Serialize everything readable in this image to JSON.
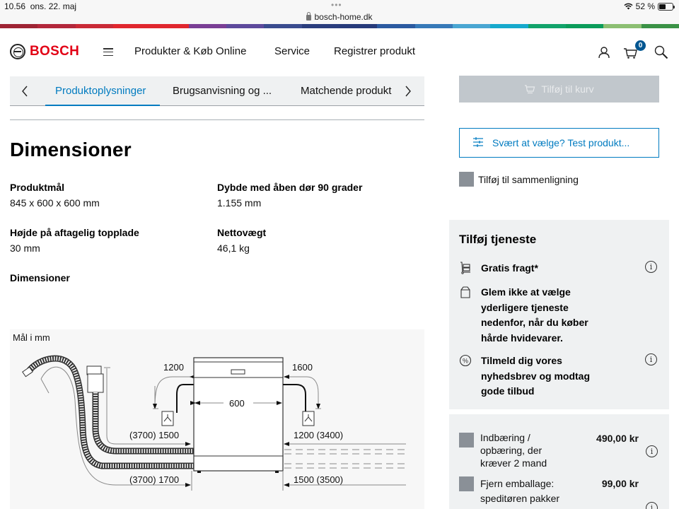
{
  "statusbar": {
    "time": "10.56",
    "date": "ons. 22. maj",
    "dots": "•••",
    "url": "bosch-home.dk",
    "battery": "52 %",
    "battery_level": 0.52
  },
  "supergraphic_colors": [
    "#9e2434",
    "#b3273b",
    "#c92a37",
    "#e0262e",
    "#e0262e",
    "#7a3e95",
    "#5d4a9c",
    "#3a4c8f",
    "#2a3d7d",
    "#263a7a",
    "#2b5aa0",
    "#3779b8",
    "#4aa6d2",
    "#16a9cc",
    "#11a36a",
    "#0b9c5a",
    "#8cbf72",
    "#3a9246"
  ],
  "header": {
    "brand": "BOSCH",
    "nav": [
      "Produkter & Køb Online",
      "Service",
      "Registrer produkt"
    ],
    "cart_count": "0",
    "brand_color": "#e20015"
  },
  "tabs": {
    "items": [
      {
        "label": "Produktoplysninger",
        "active": true
      },
      {
        "label": "Brugsanvisning og ..."
      },
      {
        "label": "Matchende produkt"
      }
    ],
    "accent_color": "#007bc0"
  },
  "main": {
    "title": "Dimensioner",
    "specs": [
      {
        "label": "Produktmål",
        "value": "845 x 600 x 600 mm"
      },
      {
        "label": "Dybde med åben dør 90 grader",
        "value": "1.155 mm"
      },
      {
        "label": "Højde på aftagelig topplade",
        "value": "30 mm"
      },
      {
        "label": "Nettovægt",
        "value": "46,1 kg"
      }
    ],
    "subheading": "Dimensioner",
    "diagram": {
      "caption": "Mål i mm",
      "labels": {
        "left_top": "1200",
        "right_top": "1600",
        "width": "600",
        "left_mid": "(3700) 1500",
        "right_mid": "1200 (3400)",
        "left_bottom": "(3700) 1700",
        "right_bottom": "1500 (3500)"
      }
    }
  },
  "sidebar": {
    "add_to_cart": "Tilføj til kurv",
    "test_product": "Svært at vælge? Test produkt...",
    "compare": "Tilføj til sammenligning",
    "service": {
      "title": "Tilføj tjeneste",
      "items": [
        {
          "icon": "delivery-cart-icon",
          "text": "Gratis fragt*",
          "info": true
        },
        {
          "icon": "shopping-bag-icon",
          "text": "Glem ikke at vælge yderligere tjeneste nedenfor, når du køber hårde hvidevarer.",
          "info": false
        },
        {
          "icon": "percent-icon",
          "text": "Tilmeld dig vores nyhedsbrev og modtag gode tilbud",
          "info": true
        }
      ]
    },
    "addons": [
      {
        "label": "Indbæring / opbæring, der kræver 2 mand",
        "price": "490,00 kr"
      },
      {
        "label": "Fjern emballage: speditøren pakker",
        "price": "99,00 kr"
      }
    ]
  }
}
